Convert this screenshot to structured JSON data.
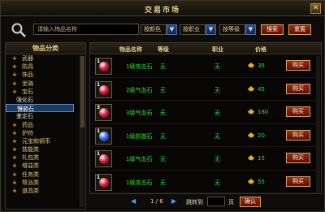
{
  "window": {
    "title": "交易市场",
    "close_label": "✕"
  },
  "search": {
    "placeholder": "请输入物品名称",
    "filter_color": "按颜色",
    "filter_job": "按职业",
    "filter_level": "按等级",
    "search_button": "搜索",
    "reset_button": "重置"
  },
  "sidebar": {
    "header": "物品分类",
    "items": [
      {
        "label": "武器",
        "type": "cat"
      },
      {
        "label": "防具",
        "type": "cat"
      },
      {
        "label": "饰品",
        "type": "cat"
      },
      {
        "label": "坐骑",
        "type": "cat"
      },
      {
        "label": "宝石",
        "type": "cat"
      },
      {
        "label": "强化石",
        "type": "sub"
      },
      {
        "label": "镶嵌石",
        "type": "sub",
        "selected": true
      },
      {
        "label": "鉴定石",
        "type": "sub"
      },
      {
        "label": "药品",
        "type": "cat"
      },
      {
        "label": "护符",
        "type": "cat"
      },
      {
        "label": "元宝和铜币",
        "type": "cat"
      },
      {
        "label": "技能类",
        "type": "cat"
      },
      {
        "label": "礼包类",
        "type": "cat"
      },
      {
        "label": "增益类",
        "type": "cat"
      },
      {
        "label": "任务类",
        "type": "cat"
      },
      {
        "label": "帮派类",
        "type": "cat"
      },
      {
        "label": "道具类",
        "type": "cat"
      }
    ]
  },
  "table": {
    "headers": {
      "name": "物品名称",
      "level": "等级",
      "job": "职业",
      "price": "价格"
    },
    "buy_label": "购买",
    "rows": [
      {
        "qty": "1",
        "name": "1级攻击石",
        "level": "无",
        "job": "无",
        "price": "35",
        "gem_color": "#e0203c"
      },
      {
        "qty": "1",
        "name": "2级气血石",
        "level": "无",
        "job": "无",
        "price": "45",
        "gem_color": "#e0203c"
      },
      {
        "qty": "3",
        "name": "3级气血石",
        "level": "无",
        "job": "无",
        "price": "180",
        "gem_color": "#e0203c"
      },
      {
        "qty": "1",
        "name": "1级防御石",
        "level": "无",
        "job": "无",
        "price": "20",
        "gem_color": "#3a6cff"
      },
      {
        "qty": "1",
        "name": "1级气血石",
        "level": "无",
        "job": "无",
        "price": "15",
        "gem_color": "#e0203c"
      },
      {
        "qty": "1",
        "name": "1级攻击石",
        "level": "无",
        "job": "无",
        "price": "55",
        "gem_color": "#e0203c"
      }
    ]
  },
  "pager": {
    "page": "1 / 6",
    "jump_label": "跳转到",
    "page_unit": "页",
    "confirm_label": "确认"
  },
  "colors": {
    "accent_gold": "#e6cf8e",
    "green_text": "#2ee02e",
    "button_red": "#9a2a1a"
  }
}
